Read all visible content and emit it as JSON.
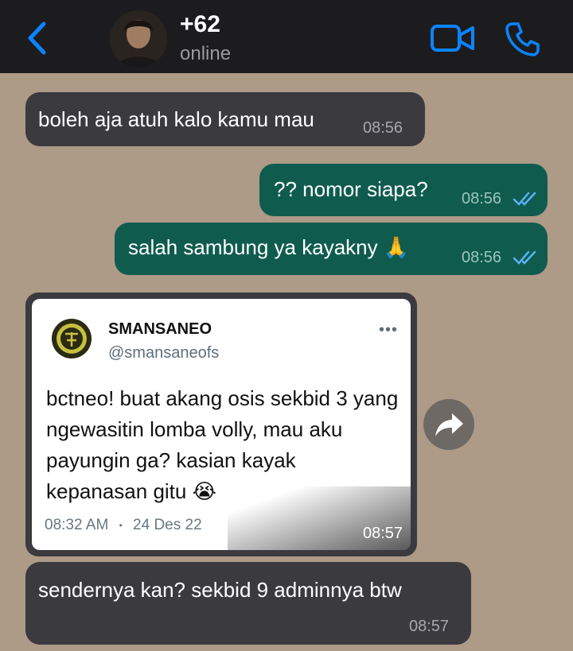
{
  "header": {
    "name": "+62",
    "status": "online"
  },
  "messages": [
    {
      "text": "boleh aja atuh kalo kamu mau",
      "time": "08:56"
    },
    {
      "text": "?? nomor siapa?",
      "time": "08:56"
    },
    {
      "text": "salah sambung ya kayakny 🙏",
      "time": "08:56"
    },
    {
      "text": "sendernya kan? sekbid 9 adminnya btw",
      "time": "08:57"
    }
  ],
  "tweet": {
    "account_name": "SMANSANEO",
    "handle": "@smansaneofs",
    "more": "•••",
    "text": "bctneo! buat akang osis sekbid 3 yang ngewasitin lomba volly, mau aku payungin ga? kasian kayak kepanasan gitu 😭",
    "meta_time": "08:32 AM",
    "meta_sep": "•",
    "meta_date": "24 Des 22",
    "message_time": "08:57"
  },
  "colors": {
    "accent": "#0a84ff",
    "wallpaper": "#ad9a87",
    "incoming": "#3b3a3f",
    "outgoing": "#0f5c4f",
    "read_ticks": "#5fb3ff"
  },
  "icons": {
    "back": "chevron-left-icon",
    "video": "video-camera-icon",
    "call": "phone-icon",
    "forward": "share-forward-icon",
    "read": "double-check-icon"
  }
}
